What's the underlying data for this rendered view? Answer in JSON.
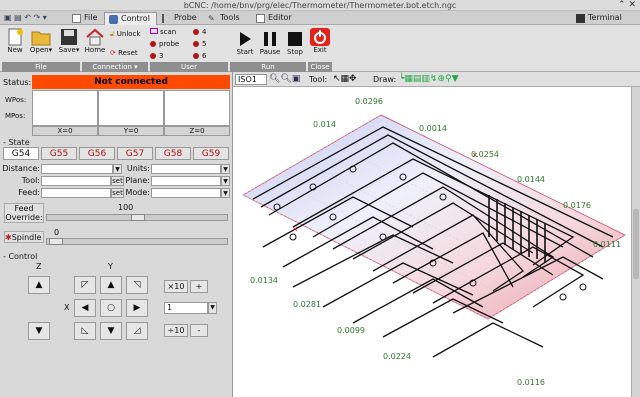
{
  "window": {
    "title": "bCNC: /home/bnv/prg/elec/Thermometer/Thermometer.bot.etch.ngc"
  },
  "tabs": [
    {
      "label": "File"
    },
    {
      "label": "Control"
    },
    {
      "label": "Probe"
    },
    {
      "label": "Tools"
    },
    {
      "label": "Editor"
    },
    {
      "label": "Terminal"
    }
  ],
  "toolbar": {
    "new": "New",
    "open": "Open",
    "save": "Save",
    "home": "Home",
    "unlock": "Unlock",
    "reset": "Reset",
    "scan": "scan",
    "probe": "probe",
    "user_buttons": [
      "3",
      "4",
      "5",
      "6"
    ],
    "start": "Start",
    "pause": "Pause",
    "stop": "Stop",
    "exit": "Exit",
    "sections": {
      "file": "File",
      "connection": "Connection",
      "user": "User",
      "run": "Run",
      "close": "Close"
    }
  },
  "status": {
    "label": "Status:",
    "value": "Not connected",
    "wpos_label": "WPos:",
    "mpos_label": "MPos:",
    "axis_buttons": [
      "X=0",
      "Y=0",
      "Z=0"
    ]
  },
  "state": {
    "header": "State",
    "gcodes": [
      "G54",
      "G55",
      "G56",
      "G57",
      "G58",
      "G59"
    ],
    "distance_label": "Distance:",
    "units_label": "Units:",
    "tool_label": "Tool:",
    "plane_label": "Plane:",
    "feed_label": "Feed:",
    "mode_label": "Mode:",
    "set_label": "set",
    "feed_override_label": "Feed Override:",
    "feed_override_value": "100",
    "spindle_label": "Spindle",
    "spindle_value": "0"
  },
  "control": {
    "header": "Control",
    "z_label": "Z",
    "y_label": "Y",
    "x_label": "X",
    "step_x10": "×10",
    "step_div10": "÷10",
    "step_value": "1",
    "plus": "+",
    "minus": "-"
  },
  "canvas_bar": {
    "view": "ISO1",
    "tool_label": "Tool:",
    "draw_label": "Draw:"
  },
  "canvas_labels": [
    "0.0296",
    "0.0014",
    "0.0254",
    "0.0144",
    "0.0176",
    "0.0134",
    "0.0281",
    "0.0099",
    "0.0224",
    "0.0116",
    "0.014",
    "0.0111"
  ]
}
